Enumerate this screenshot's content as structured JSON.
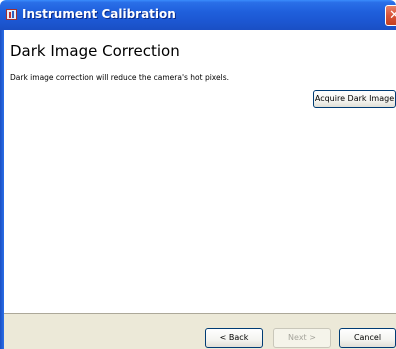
{
  "window": {
    "title": "Instrument Calibration",
    "title_icon": "instrument-app-icon",
    "close_icon": "close-icon"
  },
  "page": {
    "heading": "Dark Image Correction",
    "description": "Dark image correction will reduce the camera's hot pixels.",
    "acquire_button": "Acquire Dark Image"
  },
  "footer": {
    "back_label": "< Back",
    "next_label": "Next >",
    "cancel_label": "Cancel"
  },
  "colors": {
    "titlebar": "#1f5fdc",
    "close": "#d8543a",
    "footer_bg": "#ece9d8",
    "button_border": "#003c74"
  }
}
